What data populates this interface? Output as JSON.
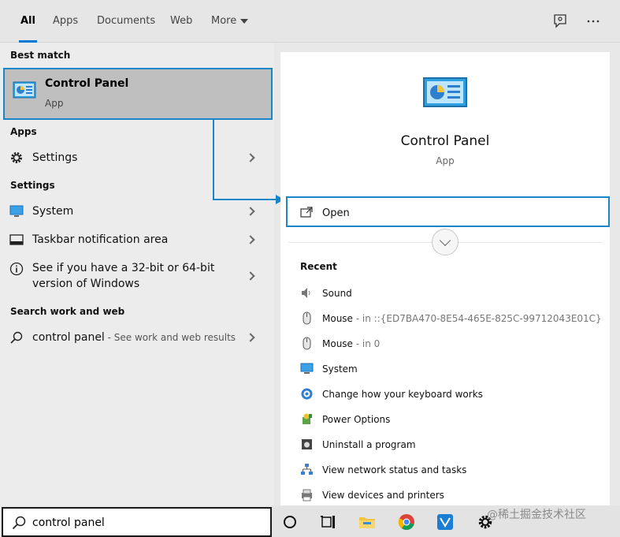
{
  "tabs": [
    {
      "label": "All",
      "active": true
    },
    {
      "label": "Apps"
    },
    {
      "label": "Documents"
    },
    {
      "label": "Web"
    },
    {
      "label": "More"
    }
  ],
  "top_icons": [
    "feedback-icon",
    "more-options-icon"
  ],
  "left": {
    "best_match_heading": "Best match",
    "best_match": {
      "title": "Control Panel",
      "subtitle": "App",
      "icon": "control-panel-icon"
    },
    "apps_heading": "Apps",
    "apps": [
      {
        "label": "Settings",
        "icon": "gear-icon"
      }
    ],
    "settings_heading": "Settings",
    "settings": [
      {
        "label": "System",
        "icon": "monitor-icon"
      },
      {
        "label": "Taskbar notification area",
        "icon": "taskbar-icon"
      },
      {
        "label": "See if you have a 32-bit or 64-bit version of Windows",
        "line1": "See if you have a 32-bit or 64-bit",
        "line2": "version of Windows",
        "icon": "info-icon"
      }
    ],
    "web_heading": "Search work and web",
    "web": [
      {
        "label": "control panel",
        "hint": " - See work and web results",
        "icon": "search-icon"
      }
    ]
  },
  "right": {
    "title": "Control Panel",
    "subtitle": "App",
    "open_label": "Open",
    "recent_heading": "Recent",
    "recent": [
      {
        "label": "Sound",
        "sub": "",
        "icon": "speaker-icon"
      },
      {
        "label": "Mouse",
        "sub": " - in ::{ED7BA470-8E54-465E-825C-99712043E01C}",
        "icon": "mouse-icon"
      },
      {
        "label": "Mouse",
        "sub": " - in 0",
        "icon": "mouse-icon"
      },
      {
        "label": "System",
        "sub": "",
        "icon": "monitor-icon"
      },
      {
        "label": "Change how your keyboard works",
        "sub": "",
        "icon": "accessibility-icon"
      },
      {
        "label": "Power Options",
        "sub": "",
        "icon": "power-options-icon"
      },
      {
        "label": "Uninstall a program",
        "sub": "",
        "icon": "programs-icon"
      },
      {
        "label": "View network status and tasks",
        "sub": "",
        "icon": "network-icon"
      },
      {
        "label": "View devices and printers",
        "sub": "",
        "icon": "printer-icon"
      }
    ]
  },
  "search": {
    "value": "control panel"
  },
  "taskbar": {
    "icons": [
      "cortana-icon",
      "task-view-icon",
      "file-explorer-icon",
      "chrome-icon",
      "vscode-icon",
      "settings-gear-icon"
    ]
  },
  "watermark": "@稀土掘金技术社区",
  "colors": {
    "accent": "#1a85c7",
    "selection": "#bfbfbf"
  }
}
